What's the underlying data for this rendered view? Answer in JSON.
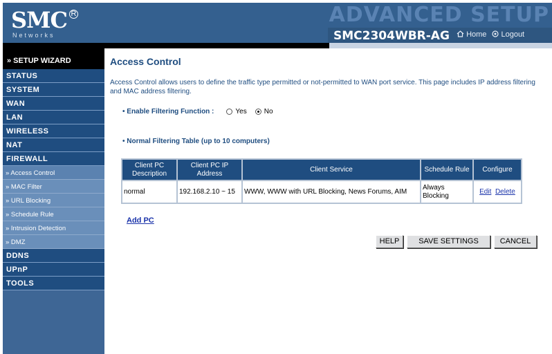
{
  "header": {
    "logo": "SMC",
    "logo_mark": "R",
    "networks": "Networks",
    "banner": "ADVANCED SETUP",
    "model": "SMC2304WBR-AG",
    "home": "Home",
    "logout": "Logout",
    "home_icon": "home-icon",
    "logout_icon": "logout-icon"
  },
  "sidebar": {
    "wizard": "» SETUP WIZARD",
    "items": [
      "STATUS",
      "SYSTEM",
      "WAN",
      "LAN",
      "WIRELESS",
      "NAT",
      "FIREWALL"
    ],
    "firewall_sub": [
      "» Access Control",
      "» MAC Filter",
      "» URL Blocking",
      "» Schedule Rule",
      "» Intrusion Detection",
      "» DMZ"
    ],
    "items_after": [
      "DDNS",
      "UPnP",
      "TOOLS"
    ]
  },
  "main": {
    "title": "Access Control",
    "description": "Access Control allows users to define the traffic type permitted or not-permitted to WAN port service. This page includes IP address filtering and MAC address filtering.",
    "filter_label": "• Enable Filtering Function :",
    "filter_yes": "Yes",
    "filter_no": "No",
    "filter_selected": "No",
    "table_title": "• Normal Filtering Table (up to 10 computers)",
    "table": {
      "headers": [
        "Client PC Description",
        "Client PC IP Address",
        "Client Service",
        "Schedule Rule",
        "Configure"
      ],
      "rows": [
        {
          "description": "normal",
          "ip": "192.168.2.10 ~ 15",
          "service": "WWW, WWW with URL Blocking, News Forums, AIM",
          "schedule": "Always Blocking",
          "edit": "Edit",
          "delete": "Delete"
        }
      ]
    },
    "add_pc": "Add PC",
    "buttons": {
      "help": "HELP",
      "save": "SAVE SETTINGS",
      "cancel": "CANCEL"
    }
  },
  "colors": {
    "header_bg": "#34608f",
    "nav_bg": "#1f4d80",
    "sub_bg": "#6a8fba",
    "title_text": "#1f4d80",
    "link": "#1a33aa"
  }
}
